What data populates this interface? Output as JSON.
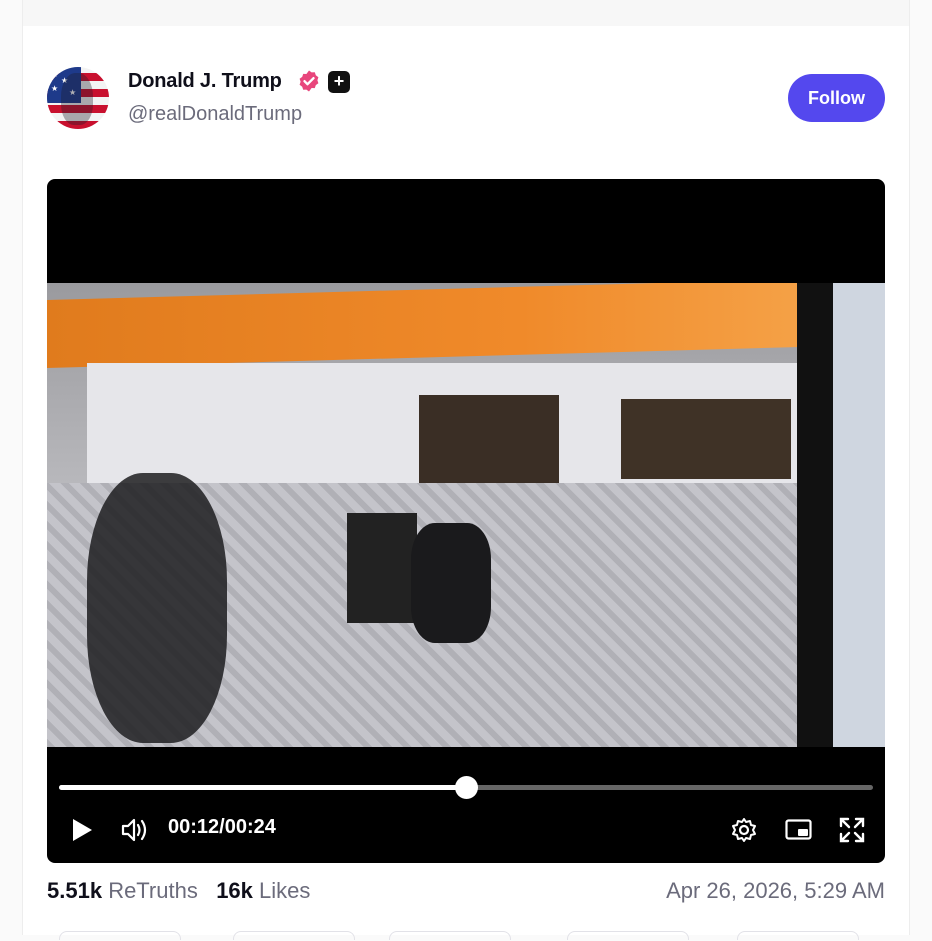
{
  "post": {
    "author": {
      "display_name": "Donald J. Trump",
      "handle": "@realDonaldTrump",
      "verified_icon": "verified-badge-icon",
      "verified_color": "#e8467c",
      "plus_badge_icon": "plus-icon",
      "plus_badge_text": "+"
    },
    "follow_label": "Follow",
    "accent_color": "#5448ee"
  },
  "video": {
    "current_time": "00:12",
    "separator": "/",
    "duration": "00:24",
    "progress": 0.5,
    "icons": [
      "play-icon",
      "volume-icon",
      "settings-icon",
      "picture-in-picture-icon",
      "fullscreen-icon"
    ]
  },
  "stats": {
    "retruths_count": "5.51k",
    "retruths_label": "ReTruths",
    "likes_count": "16k",
    "likes_label": "Likes",
    "timestamp": "Apr 26, 2026, 5:29 AM"
  }
}
